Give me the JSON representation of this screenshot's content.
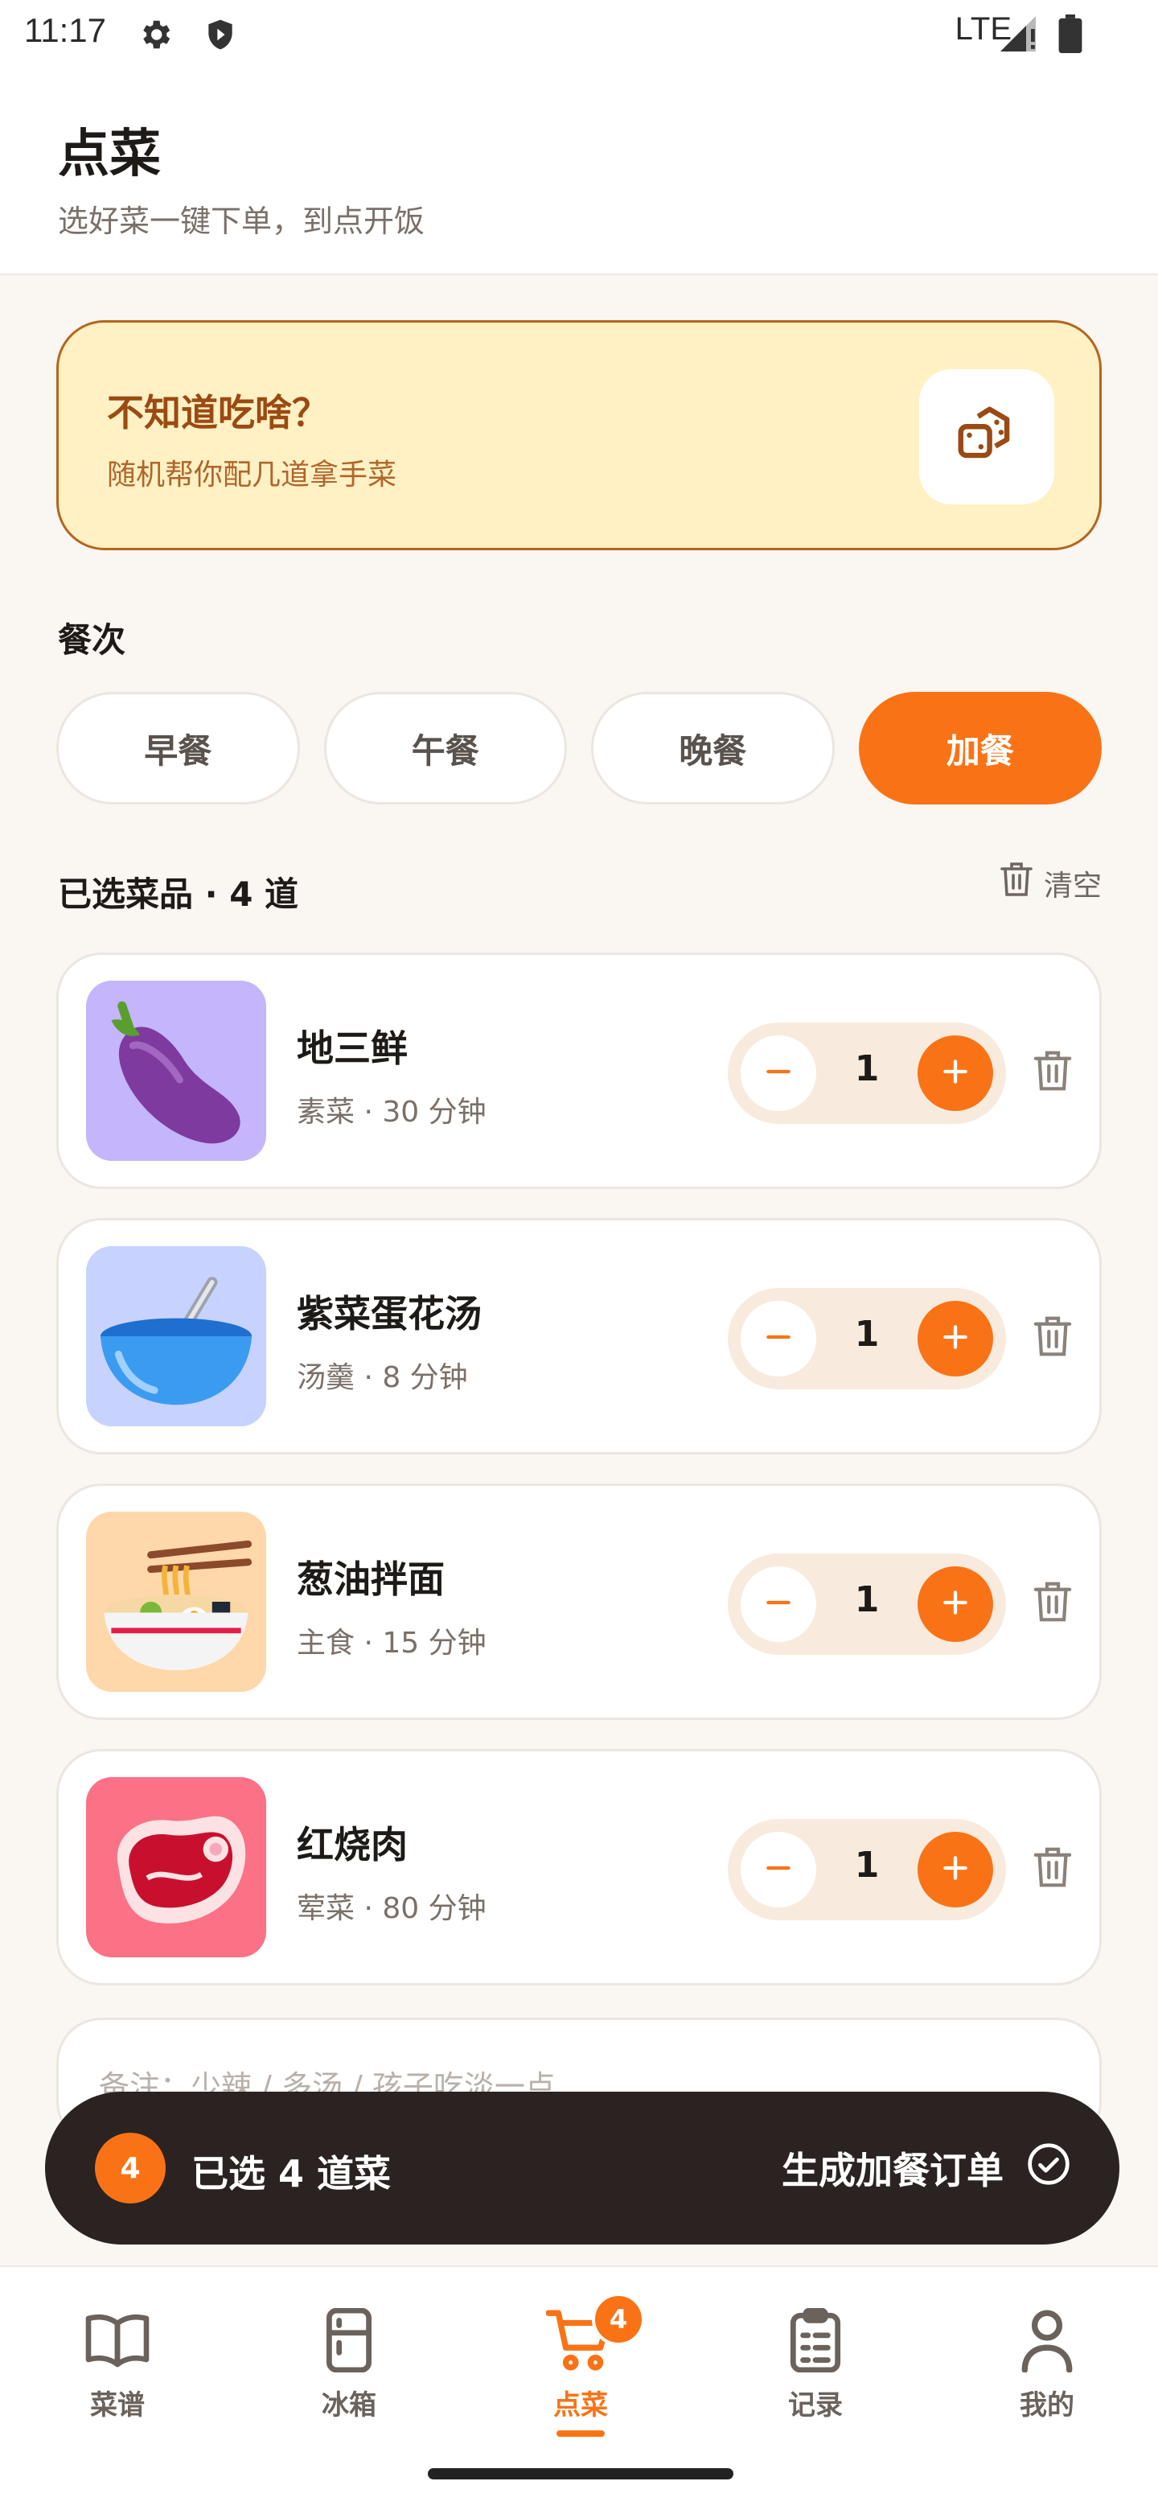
{
  "status_bar": {
    "time": "11:17",
    "network": "LTE"
  },
  "header": {
    "title": "点菜",
    "subtitle": "选好菜一键下单，到点开饭"
  },
  "random_card": {
    "title": "不知道吃啥？",
    "subtitle": "随机帮你配几道拿手菜",
    "icon": "dice-icon"
  },
  "meals": {
    "label": "餐次",
    "options": [
      "早餐",
      "午餐",
      "晚餐",
      "加餐"
    ],
    "selected": "加餐"
  },
  "selection": {
    "title": "已选菜品 · 4 道",
    "clear_label": "清空"
  },
  "dishes": [
    {
      "name": "地三鲜",
      "meta": "素菜 · 30 分钟",
      "quantity": "1",
      "icon": "eggplant-icon",
      "thumb_color": "#c4b5fd"
    },
    {
      "name": "紫菜蛋花汤",
      "meta": "汤羹 · 8 分钟",
      "quantity": "1",
      "icon": "soup-bowl-icon",
      "thumb_color": "#c7d2fe"
    },
    {
      "name": "葱油拌面",
      "meta": "主食 · 15 分钟",
      "quantity": "1",
      "icon": "noodle-bowl-icon",
      "thumb_color": "#fed7aa"
    },
    {
      "name": "红烧肉",
      "meta": "荤菜 · 80 分钟",
      "quantity": "1",
      "icon": "meat-icon",
      "thumb_color": "#fb7185"
    }
  ],
  "note": {
    "placeholder": "备注：少辣 / 多汤 / 孩子吃淡一点"
  },
  "order_bar": {
    "count": "4",
    "summary": "已选 4 道菜",
    "submit_label": "生成加餐订单"
  },
  "bottom_nav": {
    "items": [
      {
        "label": "菜谱",
        "icon": "book-icon"
      },
      {
        "label": "冰箱",
        "icon": "fridge-icon"
      },
      {
        "label": "点菜",
        "icon": "cart-icon",
        "badge": "4",
        "active": true
      },
      {
        "label": "记录",
        "icon": "clipboard-icon"
      },
      {
        "label": "我的",
        "icon": "user-icon"
      }
    ]
  },
  "colors": {
    "accent": "#f97316",
    "card_bg": "#fff1c4",
    "card_border": "#b5651d",
    "order_bar_bg": "#2a2321"
  }
}
